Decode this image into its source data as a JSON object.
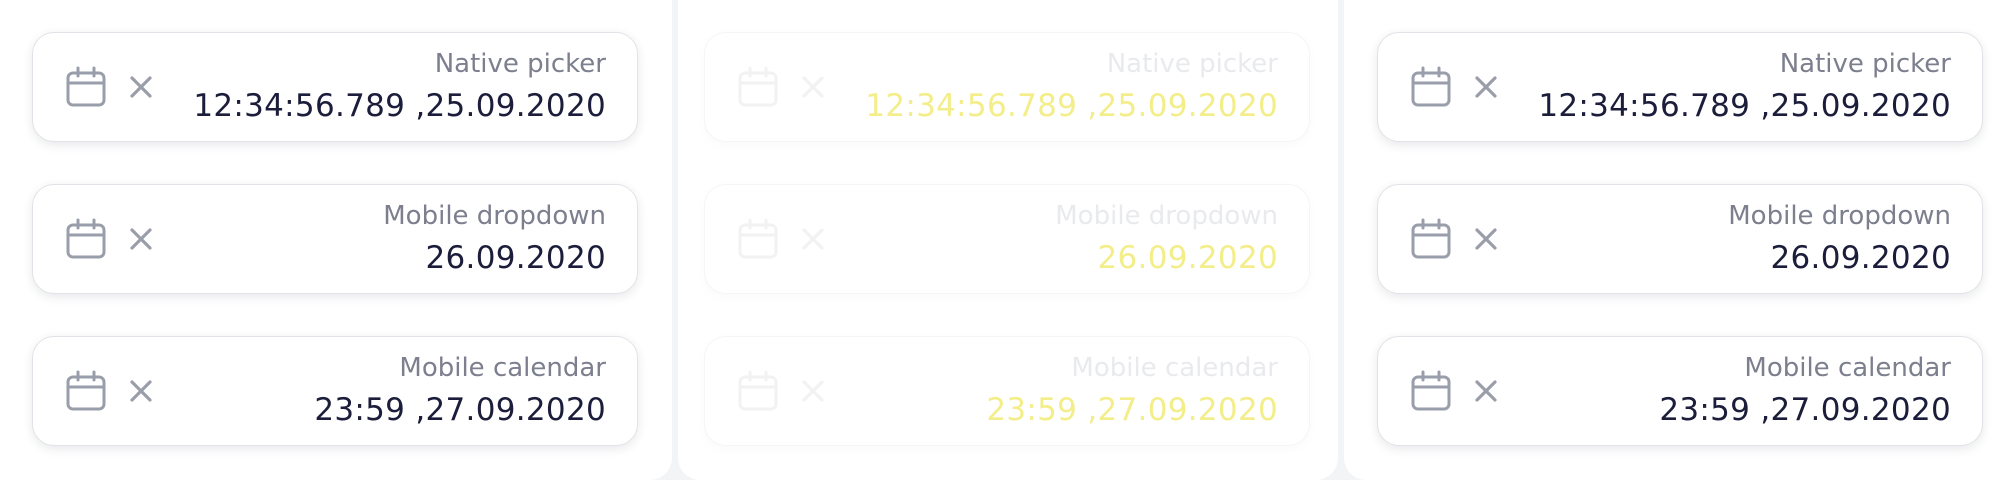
{
  "columns": [
    {
      "state": "enabled",
      "fields": [
        {
          "label": "Native picker",
          "value": "12:34:56.789 ,25.09.2020",
          "icon": "calendar-icon",
          "clear_icon": "close-icon"
        },
        {
          "label": "Mobile dropdown",
          "value": "26.09.2020",
          "icon": "calendar-icon",
          "clear_icon": "close-icon"
        },
        {
          "label": "Mobile calendar",
          "value": "23:59 ,27.09.2020",
          "icon": "calendar-icon",
          "clear_icon": "close-icon"
        }
      ]
    },
    {
      "state": "disabled",
      "fields": [
        {
          "label": "Native picker",
          "value": "12:34:56.789 ,25.09.2020",
          "icon": "calendar-icon",
          "clear_icon": "close-icon"
        },
        {
          "label": "Mobile dropdown",
          "value": "26.09.2020",
          "icon": "calendar-icon",
          "clear_icon": "close-icon"
        },
        {
          "label": "Mobile calendar",
          "value": "23:59 ,27.09.2020",
          "icon": "calendar-icon",
          "clear_icon": "close-icon"
        }
      ]
    },
    {
      "state": "enabled",
      "fields": [
        {
          "label": "Native picker",
          "value": "12:34:56.789 ,25.09.2020",
          "icon": "calendar-icon",
          "clear_icon": "close-icon"
        },
        {
          "label": "Mobile dropdown",
          "value": "26.09.2020",
          "icon": "calendar-icon",
          "clear_icon": "close-icon"
        },
        {
          "label": "Mobile calendar",
          "value": "23:59 ,27.09.2020",
          "icon": "calendar-icon",
          "clear_icon": "close-icon"
        }
      ]
    }
  ],
  "colors": {
    "page_background": "#f3f4f6",
    "card_background": "#ffffff",
    "label": "#7b7f8e",
    "value": "#1b1d3a",
    "icon": "#9a9eab",
    "disabled_value": "#f3ee8a"
  }
}
